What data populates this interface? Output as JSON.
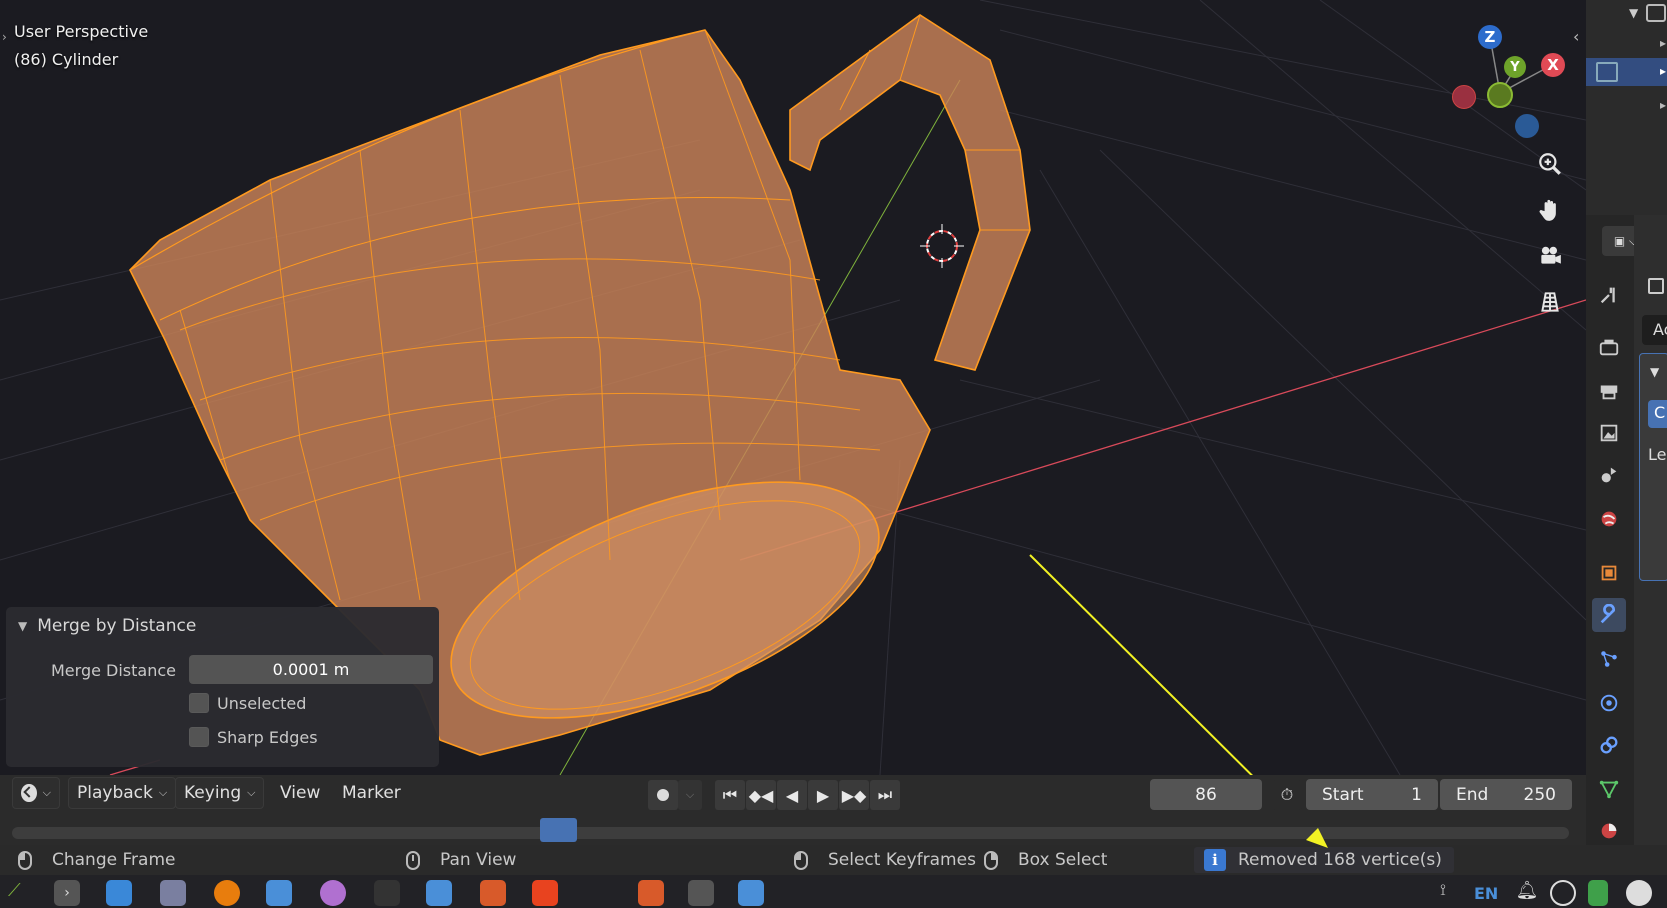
{
  "viewport": {
    "perspective": "User Perspective",
    "object": "(86) Cylinder",
    "gizmo": {
      "z": "Z",
      "y": "Y",
      "x": "X"
    },
    "nav_icons": [
      "zoom-in-icon",
      "hand-pan-icon",
      "camera-icon",
      "grid-ortho-icon"
    ],
    "colors": {
      "mesh": "#e0894f",
      "wire": "#ff9a1f",
      "bg": "#1b1b21",
      "x_axis": "#d84a5a",
      "y_axis": "#7fb33c"
    }
  },
  "operator_panel": {
    "title": "Merge by Distance",
    "merge_distance_label": "Merge Distance",
    "merge_distance_value": "0.0001 m",
    "unselected_label": "Unselected",
    "sharp_edges_label": "Sharp Edges"
  },
  "timeline": {
    "playback": "Playback",
    "keying": "Keying",
    "view": "View",
    "marker": "Marker",
    "current_frame": "86",
    "start_label": "Start",
    "start_value": "1",
    "end_label": "End",
    "end_value": "250"
  },
  "statusbar": {
    "change_frame": "Change Frame",
    "pan_view": "Pan View",
    "select_keyframes": "Select Keyframes",
    "box_select": "Box Select",
    "report": "Removed 168 vertice(s)"
  },
  "properties_panel": {
    "partial_a": "Ac",
    "partial_c": "C",
    "partial_le": "Le"
  },
  "taskbar": {
    "lang": "EN"
  },
  "accent": "#4772b3"
}
